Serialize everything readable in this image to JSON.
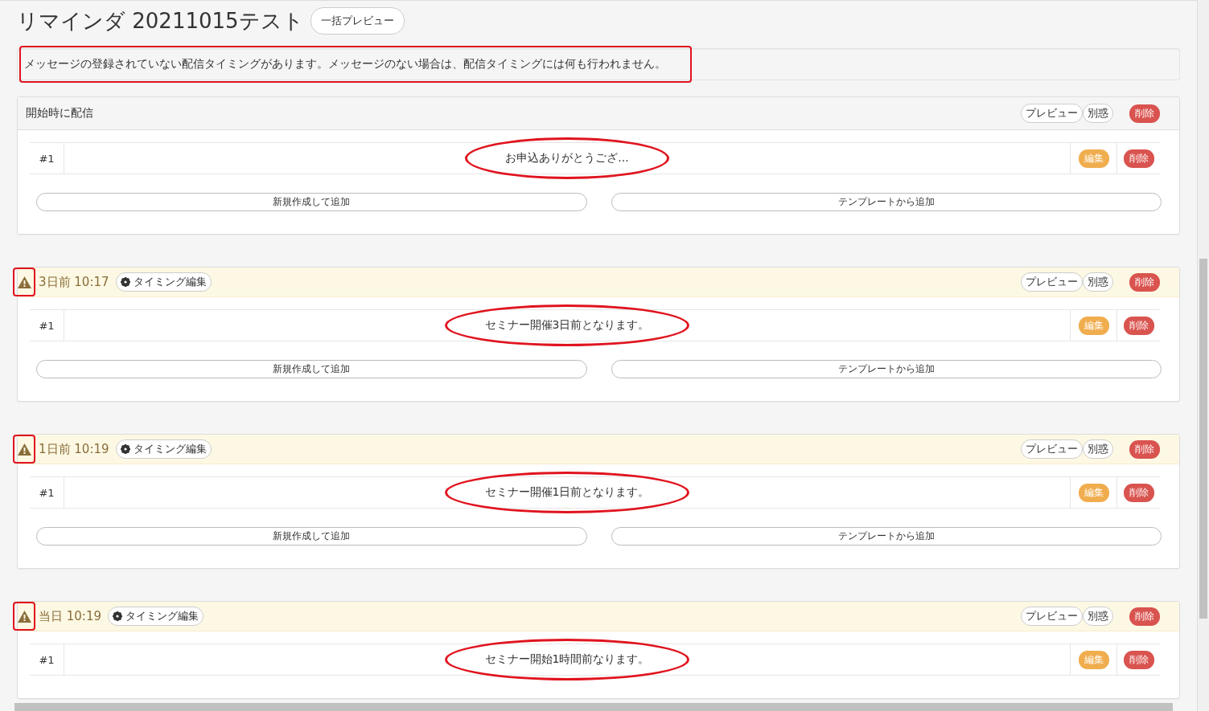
{
  "title": "リマインダ 20211015テスト",
  "bulk_preview_button": "一括プレビュー",
  "notice": {
    "text": "メッセージの登録されていない配信タイミングがあります。メッセージのない場合は、配信タイミングには何も行われません。",
    "marked": true
  },
  "sections": [
    {
      "kind": "start",
      "label": "開始時に配信",
      "buttons": [
        "プレビュー",
        "別惑",
        "削除"
      ],
      "messages": [
        {
          "number": "#1",
          "text": "お申込ありがとうござ...",
          "marked": true,
          "buttons": [
            "編集",
            "削除"
          ]
        }
      ],
      "add_buttons": [
        "新規作成して追加",
        "テンプレートから追加"
      ]
    },
    {
      "kind": "timing",
      "warning": true,
      "warning_marked": true,
      "label": "3日前 10:17",
      "timing_button": "タイミング編集",
      "buttons": [
        "プレビュー",
        "別惑",
        "削除"
      ],
      "messages": [
        {
          "number": "#1",
          "text": "セミナー開催3日前となります。",
          "marked": true,
          "buttons": [
            "編集",
            "削除"
          ]
        }
      ],
      "add_buttons": [
        "新規作成して追加",
        "テンプレートから追加"
      ]
    },
    {
      "kind": "timing",
      "warning": true,
      "warning_marked": true,
      "label": "1日前 10:19",
      "timing_button": "タイミング編集",
      "buttons": [
        "プレビュー",
        "別惑",
        "削除"
      ],
      "messages": [
        {
          "number": "#1",
          "text": "セミナー開催1日前となります。",
          "marked": true,
          "buttons": [
            "編集",
            "削除"
          ]
        }
      ],
      "add_buttons": [
        "新規作成して追加",
        "テンプレートから追加"
      ]
    },
    {
      "kind": "timing",
      "warning": true,
      "warning_marked": true,
      "label": "当日 10:19",
      "timing_button": "タイミング編集",
      "buttons": [
        "プレビュー",
        "別惑",
        "削除"
      ],
      "messages": [
        {
          "number": "#1",
          "text": "セミナー開始1時間前なります。",
          "marked": true,
          "buttons": [
            "編集",
            "削除"
          ]
        }
      ]
    }
  ]
}
